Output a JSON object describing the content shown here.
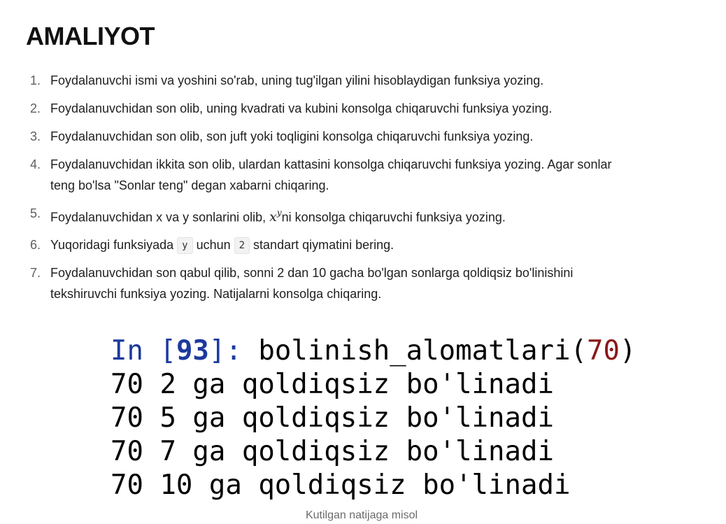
{
  "page": {
    "title": "AMALIYOT"
  },
  "tasks": [
    {
      "num": "1.",
      "text": "Foydalanuvchi ismi va yoshini so'rab, uning tug'ilgan yilini hisoblaydigan funksiya yozing."
    },
    {
      "num": "2.",
      "text": "Foydalanuvchidan son olib, uning kvadrati va kubini konsolga chiqaruvchi funksiya yozing."
    },
    {
      "num": "3.",
      "text": "Foydalanuvchidan son olib, son juft yoki toqligini konsolga chiqaruvchi funksiya yozing."
    },
    {
      "num": "4.",
      "line1": "Foydalanuvchidan ikkita son olib, ulardan kattasini konsolga chiqaruvchi funksiya yozing. Agar sonlar",
      "line2": "teng bo'lsa \"Sonlar teng\" degan xabarni chiqaring."
    },
    {
      "num": "5.",
      "before": "Foydalanuvchidan x va y sonlarini olib, ",
      "math_base": "x",
      "math_exp": "y",
      "after": "ni konsolga chiqaruvchi funksiya yozing."
    },
    {
      "num": "6.",
      "before": "Yuqoridagi funksiyada ",
      "code1": "y",
      "middle": " uchun ",
      "code2": "2",
      "after": " standart qiymatini bering."
    },
    {
      "num": "7.",
      "line1": "Foydalanuvchidan son qabul qilib, sonni 2 dan 10 gacha bo'lgan sonlarga qoldiqsiz bo'linishini",
      "line2": "tekshiruvchi funksiya yozing. Natijalarni konsolga chiqaring."
    }
  ],
  "console": {
    "prompt_in": "In ",
    "prompt_open": "[",
    "prompt_num": "93",
    "prompt_close": "]: ",
    "call_name": "bolinish_alomatlari(",
    "call_arg": "70",
    "call_close": ")",
    "output": [
      "70 2 ga qoldiqsiz bo'linadi",
      "70 5 ga qoldiqsiz bo'linadi",
      "70 7 ga qoldiqsiz bo'linadi",
      "70 10 ga qoldiqsiz bo'linadi"
    ]
  },
  "figure": {
    "caption": "Kutilgan natijaga misol"
  },
  "colors": {
    "prompt": "#1c3a9c",
    "argument": "#8a1818",
    "caption": "#6b6b6b"
  }
}
